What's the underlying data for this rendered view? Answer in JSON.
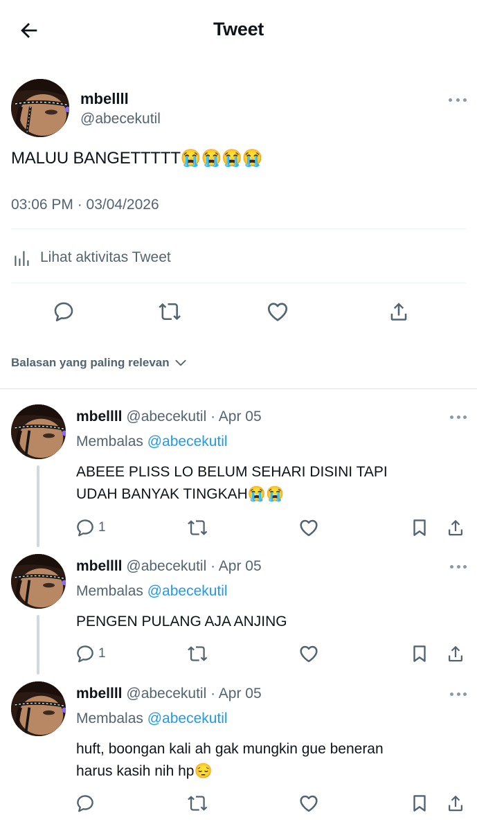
{
  "header": {
    "title": "Tweet"
  },
  "tweet": {
    "author_name": "mbellll",
    "author_handle": "@abecekutil",
    "text": "MALUU BANGETTTTT",
    "emojis": [
      "😭",
      "😭",
      "😭",
      "😭"
    ],
    "timestamp": "03:06 PM · 03/04/2026",
    "activity_label": "Lihat aktivitas Tweet"
  },
  "sort": {
    "label": "Balasan yang paling relevan"
  },
  "replies": [
    {
      "author_name": "mbellll",
      "meta": "@abecekutil · Apr 05",
      "replying_prefix": "Membalas",
      "replying_to": "@abecekutil",
      "text_line1": "ABEEE PLISS LO BELUM SEHARI DISINI TAPI",
      "text_line2": "UDAH BANYAK TINGKAH",
      "emojis": [
        "😭",
        "😭"
      ],
      "reply_count": "1"
    },
    {
      "author_name": "mbellll",
      "meta": "@abecekutil · Apr 05",
      "replying_prefix": "Membalas",
      "replying_to": "@abecekutil",
      "text_line1": "PENGEN PULANG AJA ANJING",
      "text_line2": "",
      "emojis": [],
      "reply_count": "1"
    },
    {
      "author_name": "mbellll",
      "meta": "@abecekutil · Apr 05",
      "replying_prefix": "Membalas",
      "replying_to": "@abecekutil",
      "text_line1": "huft, boongan kali ah gak mungkin gue beneran",
      "text_line2": "harus kasih nih hp",
      "emojis": [
        "😔"
      ],
      "reply_count": ""
    }
  ],
  "icons": {
    "back": "arrow-left-icon",
    "reply": "speech-bubble-icon",
    "retweet": "retweet-icon",
    "like": "heart-icon",
    "share": "share-upload-icon",
    "bookmark": "bookmark-icon",
    "activity": "bar-chart-icon",
    "more": "more-dots-icon"
  },
  "colors": {
    "text": "#0f1419",
    "secondary": "#536471",
    "link": "#1d9bf0",
    "icon": "#536471"
  }
}
